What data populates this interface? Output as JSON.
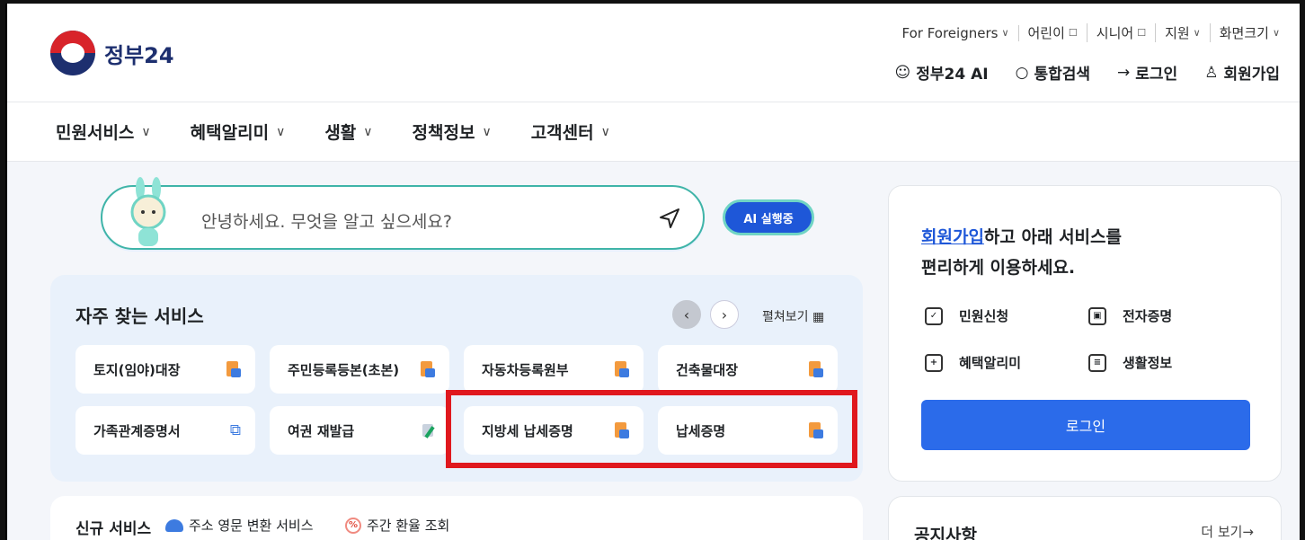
{
  "header": {
    "logo_text": "정부24",
    "utility_links": [
      {
        "label": "For Foreigners",
        "icon": "chevron-down-icon"
      },
      {
        "label": "어린이",
        "icon": "external-link-icon"
      },
      {
        "label": "시니어",
        "icon": "external-link-icon"
      },
      {
        "label": "지원",
        "icon": "chevron-down-icon"
      },
      {
        "label": "화면크기",
        "icon": "chevron-down-icon"
      }
    ],
    "actions": [
      {
        "label": "정부24 AI",
        "icon": "ai-bunny-icon"
      },
      {
        "label": "통합검색",
        "icon": "search-icon"
      },
      {
        "label": "로그인",
        "icon": "login-icon"
      },
      {
        "label": "회원가입",
        "icon": "user-add-icon"
      }
    ]
  },
  "nav": {
    "items": [
      "민원서비스",
      "혜택알리미",
      "생활",
      "정책정보",
      "고객센터"
    ]
  },
  "search": {
    "placeholder": "안녕하세요. 무엇을 알고 싶으세요?",
    "ai_button": "AI 실행중"
  },
  "frequent": {
    "title": "자주 찾는 서비스",
    "expand_label": "펼쳐보기",
    "cards": [
      {
        "label": "토지(임야)대장",
        "icon": "document-icon"
      },
      {
        "label": "주민등록등본(초본)",
        "icon": "document-icon"
      },
      {
        "label": "자동차등록원부",
        "icon": "document-icon"
      },
      {
        "label": "건축물대장",
        "icon": "document-icon"
      },
      {
        "label": "가족관계증명서",
        "icon": "external-link-icon"
      },
      {
        "label": "여권 재발급",
        "icon": "edit-document-icon"
      },
      {
        "label": "지방세 납세증명",
        "icon": "document-icon"
      },
      {
        "label": "납세증명",
        "icon": "document-icon"
      }
    ]
  },
  "new_services": {
    "title": "신규 서비스",
    "items": [
      "주소 영문 변환 서비스",
      "주간 환율 조회"
    ]
  },
  "login_panel": {
    "msg_link": "회원가입",
    "msg_rest": "하고 아래 서비스를",
    "msg_line2": "편리하게 이용하세요.",
    "services": [
      "민원신청",
      "전자증명",
      "혜택알리미",
      "생활정보"
    ],
    "login_button": "로그인"
  },
  "notice": {
    "title": "공지사항",
    "more": "더 보기→"
  },
  "colors": {
    "primary": "#2b6bea",
    "highlight": "#e0181e",
    "teal": "#3fb4a8"
  }
}
